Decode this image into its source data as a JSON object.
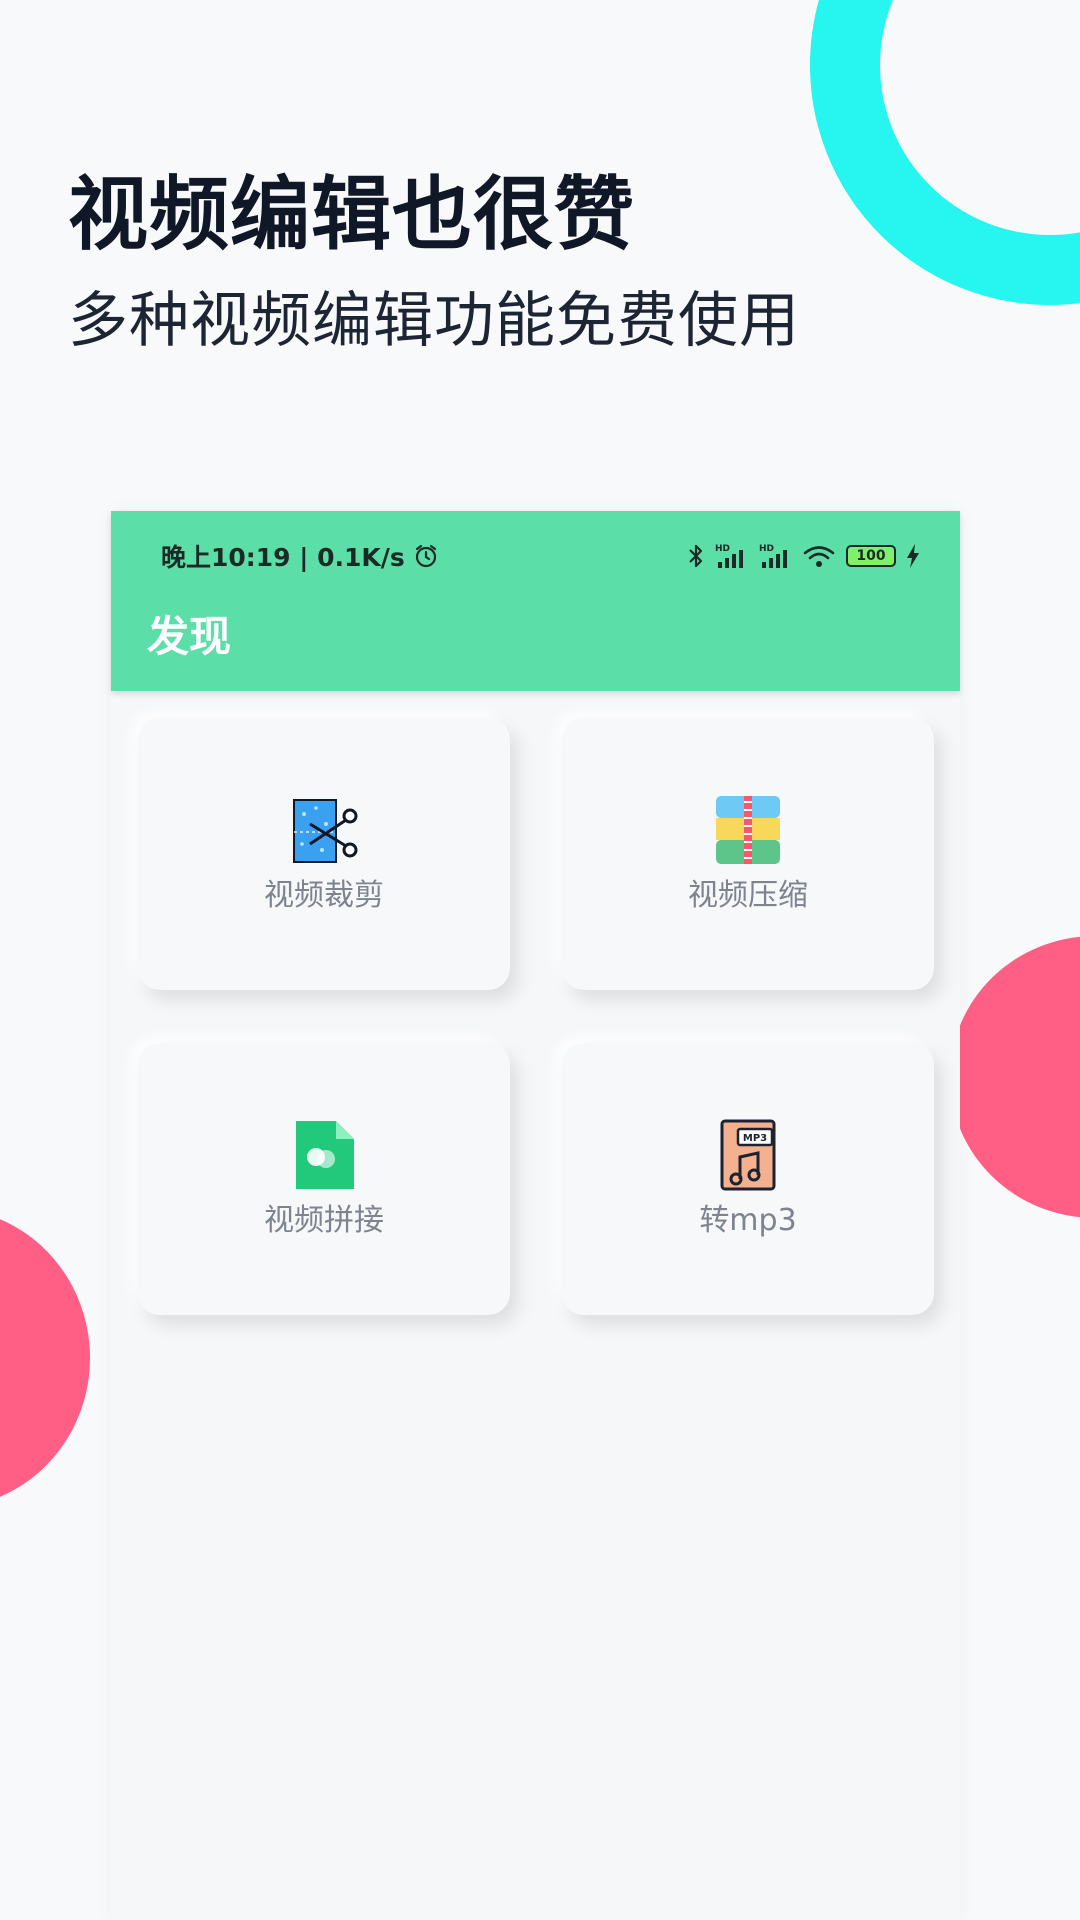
{
  "hero": {
    "title": "视频编辑也很赞",
    "subtitle": "多种视频编辑功能免费使用"
  },
  "status_bar": {
    "time_speed": "晚上10:19 | 0.1K/s",
    "signal1_label": "HD",
    "signal2_label": "HD",
    "battery": "100"
  },
  "app": {
    "title": "发现"
  },
  "features": [
    {
      "label": "视频裁剪",
      "icon": "video-crop-icon"
    },
    {
      "label": "视频压缩",
      "icon": "video-compress-icon"
    },
    {
      "label": "视频拼接",
      "icon": "video-merge-icon"
    },
    {
      "label": "转mp3",
      "icon": "convert-mp3-icon",
      "badge": "MP3"
    }
  ],
  "colors": {
    "accent_green": "#5bdea8",
    "ring_cyan": "#26f5f0",
    "blob_pink": "#ff5f84"
  }
}
